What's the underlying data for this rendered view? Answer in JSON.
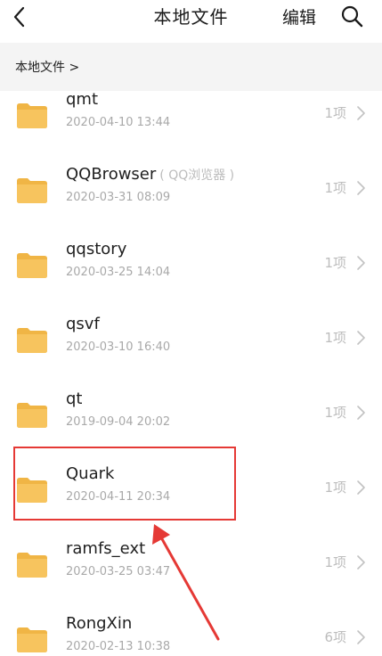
{
  "header": {
    "title": "本地文件",
    "edit_label": "编辑"
  },
  "breadcrumb": {
    "text": "本地文件 >"
  },
  "folders": [
    {
      "name": "qmt",
      "subname": "",
      "date": "2020-04-10 13:44",
      "count": "1项"
    },
    {
      "name": "QQBrowser",
      "subname": "( QQ浏览器 )",
      "date": "2020-03-31 08:09",
      "count": "1项"
    },
    {
      "name": "qqstory",
      "subname": "",
      "date": "2020-03-25 14:04",
      "count": "1项"
    },
    {
      "name": "qsvf",
      "subname": "",
      "date": "2020-03-10 16:40",
      "count": "1项"
    },
    {
      "name": "qt",
      "subname": "",
      "date": "2019-09-04 20:02",
      "count": "1项"
    },
    {
      "name": "Quark",
      "subname": "",
      "date": "2020-04-11 20:34",
      "count": "1项"
    },
    {
      "name": "ramfs_ext",
      "subname": "",
      "date": "2020-03-25 03:47",
      "count": "1项"
    },
    {
      "name": "RongXin",
      "subname": "",
      "date": "2020-02-13 10:38",
      "count": "6项"
    }
  ],
  "colors": {
    "folder": "#f7c45e",
    "folder_dark": "#f0b545",
    "highlight": "#e53935"
  },
  "icons": {
    "back": "chevron-left-icon",
    "search": "search-icon",
    "folder": "folder-icon",
    "row_chevron": "chevron-right-icon"
  }
}
